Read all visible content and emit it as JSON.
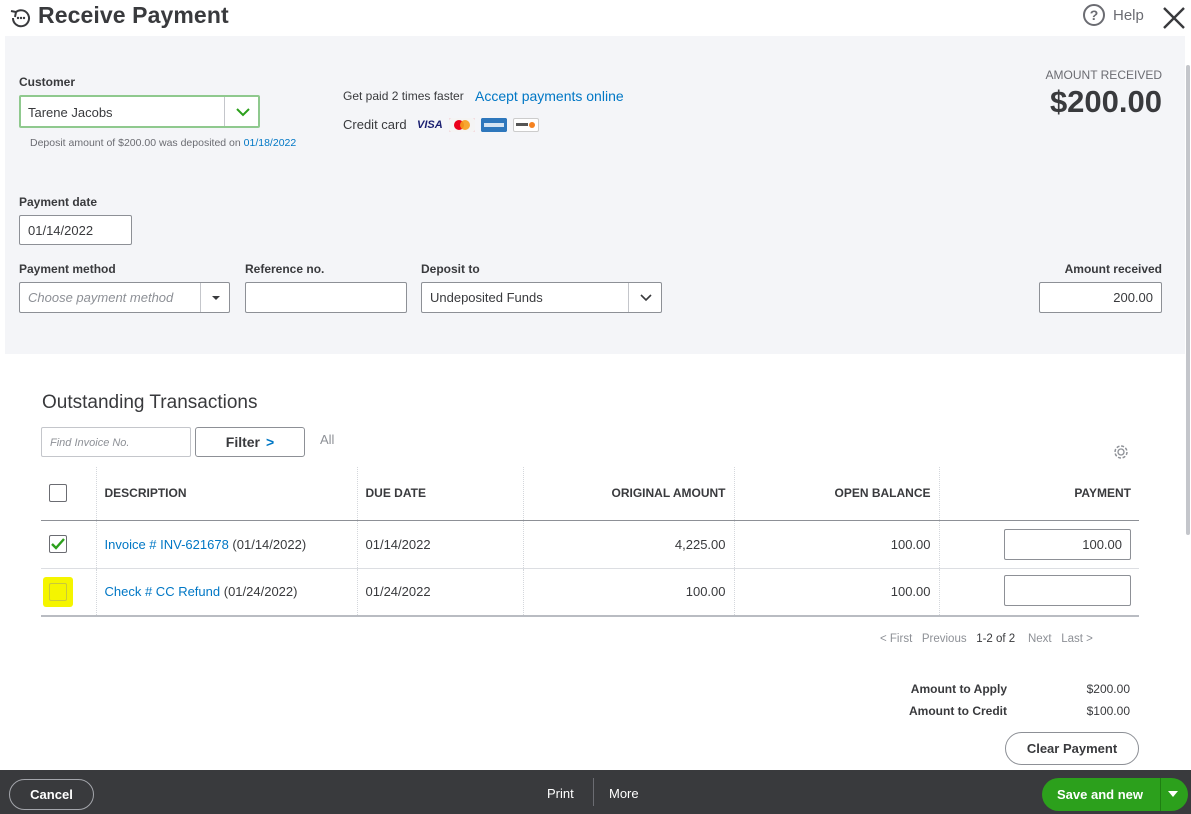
{
  "header": {
    "title": "Receive Payment",
    "help_symbol": "?",
    "help_label": "Help",
    "icons": {
      "app": "history-icon",
      "help": "question-circle-icon",
      "close": "close-icon"
    }
  },
  "customer": {
    "label": "Customer",
    "value": "Tarene Jacobs",
    "deposit_note_prefix": "Deposit amount of $200.00 was deposited on ",
    "deposit_note_date": "01/18/2022"
  },
  "promo": {
    "get_paid": "Get paid 2 times faster",
    "accept_link": "Accept payments online",
    "credit_card_label": "Credit card",
    "cards": [
      "VISA",
      "MasterCard",
      "American Express",
      "Discover"
    ]
  },
  "amount_received_summary": {
    "label": "AMOUNT RECEIVED",
    "value": "$200.00"
  },
  "payment_date": {
    "label": "Payment date",
    "value": "01/14/2022"
  },
  "payment_method": {
    "label": "Payment method",
    "placeholder": "Choose payment method"
  },
  "reference_no": {
    "label": "Reference no.",
    "value": ""
  },
  "deposit_to": {
    "label": "Deposit to",
    "value": "Undeposited Funds"
  },
  "amount_received_field": {
    "label": "Amount received",
    "value": "200.00"
  },
  "outstanding": {
    "title": "Outstanding Transactions",
    "find_placeholder": "Find Invoice No.",
    "filter_label": "Filter",
    "filter_chevron": ">",
    "all_label": "All",
    "columns": [
      "DESCRIPTION",
      "DUE DATE",
      "ORIGINAL AMOUNT",
      "OPEN BALANCE",
      "PAYMENT"
    ],
    "rows": [
      {
        "checked": true,
        "highlighted": false,
        "link": "Invoice # INV-621678",
        "date_suffix": " (01/14/2022)",
        "due_date": "01/14/2022",
        "original_amount": "4,225.00",
        "open_balance": "100.00",
        "payment": "100.00"
      },
      {
        "checked": false,
        "highlighted": true,
        "link": "Check # CC Refund",
        "date_suffix": " (01/24/2022)",
        "due_date": "01/24/2022",
        "original_amount": "100.00",
        "open_balance": "100.00",
        "payment": ""
      }
    ],
    "pager": {
      "first": "< First",
      "previous": "Previous",
      "current": "1-2 of 2",
      "next": "Next",
      "last": "Last >"
    }
  },
  "totals": {
    "apply_label": "Amount to Apply",
    "apply_value": "$200.00",
    "credit_label": "Amount to Credit",
    "credit_value": "$100.00"
  },
  "clear_payment_label": "Clear Payment",
  "footer": {
    "cancel_label": "Cancel",
    "print_label": "Print",
    "more_label": "More",
    "save_label": "Save and new"
  },
  "colors": {
    "accent_green": "#2ca01c",
    "link_blue": "#0077c5",
    "footer_bg": "#393a3d",
    "highlight_yellow": "#f5f500"
  }
}
